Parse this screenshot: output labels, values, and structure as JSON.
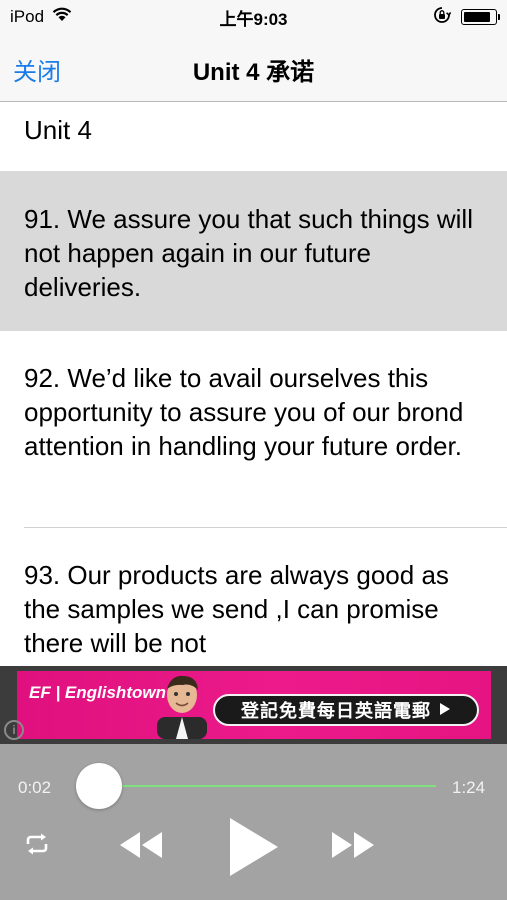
{
  "status_bar": {
    "carrier": "iPod",
    "time": "上午9:03",
    "battery_level": 0.85
  },
  "nav": {
    "close_label": "关闭",
    "title": "Unit 4 承诺"
  },
  "content": {
    "unit_heading": "Unit 4",
    "sentences": [
      {
        "text": "91. We assure you that such things will not happen again in our future deliveries."
      },
      {
        "text": "92. We’d like to avail ourselves this opportunity to assure you of our brond attention in handling your future order."
      },
      {
        "text": "93. Our products are always good as the samples we send ,I can promise there will be not"
      }
    ]
  },
  "ad": {
    "logo": "EF | Englishtown",
    "cta": "登記免費每日英語電郵",
    "info": "i"
  },
  "player": {
    "elapsed": "0:02",
    "total": "1:24",
    "progress": 0.024
  },
  "colors": {
    "accent": "#1a7ce8",
    "ad_pink": "#e0107f",
    "track": "#7ee07e",
    "highlight": "#d9d9d9"
  }
}
